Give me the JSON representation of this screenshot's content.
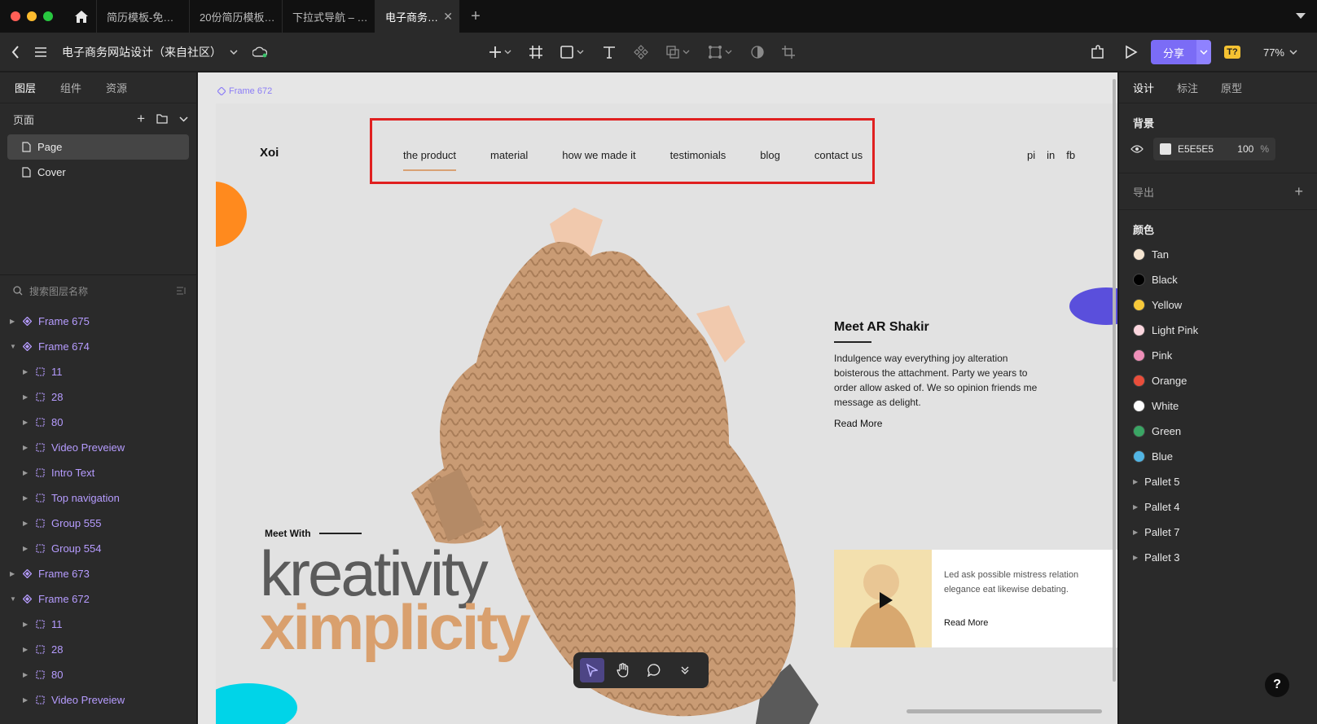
{
  "colors": {
    "accent": "#7b6cf6",
    "close": "#ff5f57",
    "minimize": "#febc2e",
    "maximize": "#28c840"
  },
  "tabs": [
    {
      "label": "简历模板-免…"
    },
    {
      "label": "20份简历模板…"
    },
    {
      "label": "下拉式导航 – …"
    },
    {
      "label": "电子商务…",
      "active": true
    }
  ],
  "toolbar": {
    "doc_title": "电子商务网站设计（来自社区）",
    "share_label": "分享",
    "zoom": "77%",
    "plugin_badge": "T?"
  },
  "left_panel": {
    "tabs": [
      "图层",
      "组件",
      "资源"
    ],
    "pages_title": "页面",
    "pages": [
      "Page",
      "Cover"
    ],
    "search_placeholder": "搜索图层名称",
    "layers": [
      {
        "name": "Frame 675",
        "type": "frame",
        "level": 0,
        "expanded": false
      },
      {
        "name": "Frame 674",
        "type": "frame",
        "level": 0,
        "expanded": true
      },
      {
        "name": "11",
        "type": "group",
        "level": 1
      },
      {
        "name": "28",
        "type": "group",
        "level": 1
      },
      {
        "name": "80",
        "type": "group",
        "level": 1
      },
      {
        "name": "Video Preveiew",
        "type": "group",
        "level": 1
      },
      {
        "name": "Intro Text",
        "type": "group",
        "level": 1
      },
      {
        "name": "Top navigation",
        "type": "group",
        "level": 1
      },
      {
        "name": "Group 555",
        "type": "group",
        "level": 1
      },
      {
        "name": "Group 554",
        "type": "group",
        "level": 1
      },
      {
        "name": "Frame 673",
        "type": "frame",
        "level": 0,
        "expanded": false
      },
      {
        "name": "Frame 672",
        "type": "frame",
        "level": 0,
        "expanded": true
      },
      {
        "name": "11",
        "type": "group",
        "level": 1
      },
      {
        "name": "28",
        "type": "group",
        "level": 1
      },
      {
        "name": "80",
        "type": "group",
        "level": 1
      },
      {
        "name": "Video Preveiew",
        "type": "group",
        "level": 1
      }
    ]
  },
  "canvas": {
    "frame_label": "Frame 672",
    "site": {
      "logo": "Xoi",
      "nav": [
        "the product",
        "material",
        "how we made it",
        "testimonials",
        "blog",
        "contact us"
      ],
      "social": [
        "pi",
        "in",
        "fb"
      ],
      "meet_title": "Meet AR Shakir",
      "meet_text": "Indulgence way everything joy alteration boisterous the attachment. Party we years to order allow asked of. We so opinion friends me message as delight.",
      "read_more": "Read More",
      "meet_with": "Meet With",
      "headline_1": "kreativity",
      "headline_2": "ximplicity",
      "video_text": "Led ask possible mistress relation elegance eat likewise debating.",
      "video_read_more": "Read More"
    }
  },
  "right_panel": {
    "tabs": [
      "设计",
      "标注",
      "原型"
    ],
    "background_title": "背景",
    "bg_hex": "E5E5E5",
    "bg_opacity": "100",
    "bg_unit": "%",
    "export_title": "导出",
    "colors_title": "颜色",
    "colors": [
      {
        "name": "Tan",
        "hex": "#f6e6d2"
      },
      {
        "name": "Black",
        "hex": "#000000"
      },
      {
        "name": "Yellow",
        "hex": "#f7c93a"
      },
      {
        "name": "Light Pink",
        "hex": "#fbd6de"
      },
      {
        "name": "Pink",
        "hex": "#ee8fb8"
      },
      {
        "name": "Orange",
        "hex": "#e94e3b"
      },
      {
        "name": "White",
        "hex": "#ffffff"
      },
      {
        "name": "Green",
        "hex": "#3aa564"
      },
      {
        "name": "Blue",
        "hex": "#52b5e4"
      }
    ],
    "pallets": [
      "Pallet 5",
      "Pallet 4",
      "Pallet 7",
      "Pallet 3"
    ]
  },
  "help_label": "?"
}
